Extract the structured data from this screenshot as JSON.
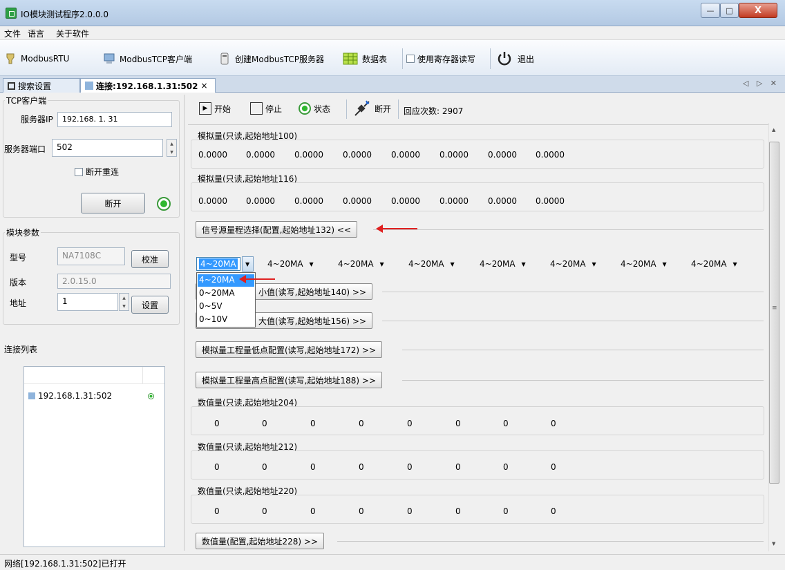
{
  "window": {
    "title": "IO模块测试程序2.0.0.0",
    "close_label": "X",
    "min_label": "—",
    "max_label": "□"
  },
  "menu": [
    "文件",
    "语言",
    "关于软件"
  ],
  "toolbar": {
    "modbus_rtu": "ModbusRTU",
    "modbus_tcp_client": "ModbusTCP客户端",
    "create_server": "创建ModbusTCP服务器",
    "data_table": "数据表",
    "use_register": "使用寄存器读写",
    "exit": "退出"
  },
  "tabs": {
    "search": "搜索设置",
    "connection": "连接:192.168.1.31:502",
    "close": "×",
    "nav": "◁ ▷ ✕"
  },
  "tcp_client": {
    "group_title": "TCP客户端",
    "server_ip_label": "服务器IP",
    "server_ip": "192.168.  1. 31",
    "port_label": "服务器端口",
    "port": "502",
    "reconnect_label": "断开重连",
    "disconnect_button": "断开"
  },
  "module_params": {
    "group_title": "模块参数",
    "model_label": "型号",
    "model": "NA7108C",
    "calibrate_button": "校准",
    "version_label": "版本",
    "version": "2.0.15.0",
    "address_label": "地址",
    "address": "1",
    "set_button": "设置"
  },
  "connection_list": {
    "group_title": "连接列表",
    "items": [
      "192.168.1.31:502"
    ]
  },
  "run_bar": {
    "start": "开始",
    "stop": "停止",
    "status": "状态",
    "disconnect": "断开",
    "response_count": "回应次数: 2907"
  },
  "groups": {
    "analog100": {
      "title": "模拟量(只读,起始地址100)",
      "values": [
        "0.0000",
        "0.0000",
        "0.0000",
        "0.0000",
        "0.0000",
        "0.0000",
        "0.0000",
        "0.0000"
      ]
    },
    "analog116": {
      "title": "模拟量(只读,起始地址116)",
      "values": [
        "0.0000",
        "0.0000",
        "0.0000",
        "0.0000",
        "0.0000",
        "0.0000",
        "0.0000",
        "0.0000"
      ]
    },
    "signal_range_button": "信号源量程选择(配置,起始地址132) <<",
    "ranges": [
      "4~20MA",
      "4~20MA",
      "4~20MA",
      "4~20MA",
      "4~20MA",
      "4~20MA",
      "4~20MA",
      "4~20MA"
    ],
    "dropdown_options": [
      "4~20MA",
      "0~20MA",
      "0~5V",
      "0~10V"
    ],
    "min_button": "小值(读写,起始地址140) >>",
    "max_button": "大值(读写,起始地址156) >>",
    "low_point_button": "模拟量工程量低点配置(读写,起始地址172) >>",
    "high_point_button": "模拟量工程量高点配置(读写,起始地址188) >>",
    "digital204": {
      "title": "数值量(只读,起始地址204)",
      "values": [
        "0",
        "0",
        "0",
        "0",
        "0",
        "0",
        "0",
        "0"
      ]
    },
    "digital212": {
      "title": "数值量(只读,起始地址212)",
      "values": [
        "0",
        "0",
        "0",
        "0",
        "0",
        "0",
        "0",
        "0"
      ]
    },
    "digital220": {
      "title": "数值量(只读,起始地址220)",
      "values": [
        "0",
        "0",
        "0",
        "0",
        "0",
        "0",
        "0",
        "0"
      ]
    },
    "digital_config_button": "数值量(配置,起始地址228) >>"
  },
  "status_bar": "网络[192.168.1.31:502]已打开"
}
